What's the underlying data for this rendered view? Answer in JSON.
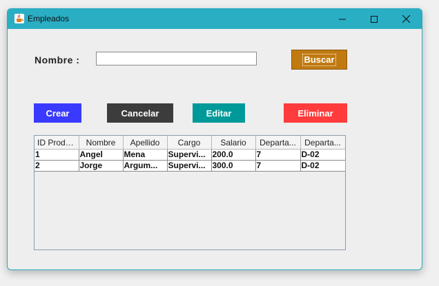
{
  "window": {
    "title": "Empleados",
    "title_icon": "java-cup-icon"
  },
  "form": {
    "nombre_label": "Nombre :",
    "nombre_value": "",
    "buscar_label": "Buscar"
  },
  "actions": {
    "crear_label": "Crear",
    "cancelar_label": "Cancelar",
    "editar_label": "Editar",
    "eliminar_label": "Eliminar"
  },
  "colors": {
    "titlebar": "#2aaec4",
    "buscar": "#c07a10",
    "crear": "#3a3aff",
    "cancelar": "#3c3c3c",
    "editar": "#009999",
    "eliminar": "#ff3b3b"
  },
  "table": {
    "columns": [
      "ID Produ...",
      "Nombre",
      "Apellido",
      "Cargo",
      "Salario",
      "Departa...",
      "Departa..."
    ],
    "rows": [
      [
        "1",
        "Angel",
        "Mena",
        "Supervi...",
        "200.0",
        "7",
        "D-02"
      ],
      [
        "2",
        "Jorge",
        "Argum...",
        "Supervi...",
        "300.0",
        "7",
        "D-02"
      ]
    ]
  }
}
